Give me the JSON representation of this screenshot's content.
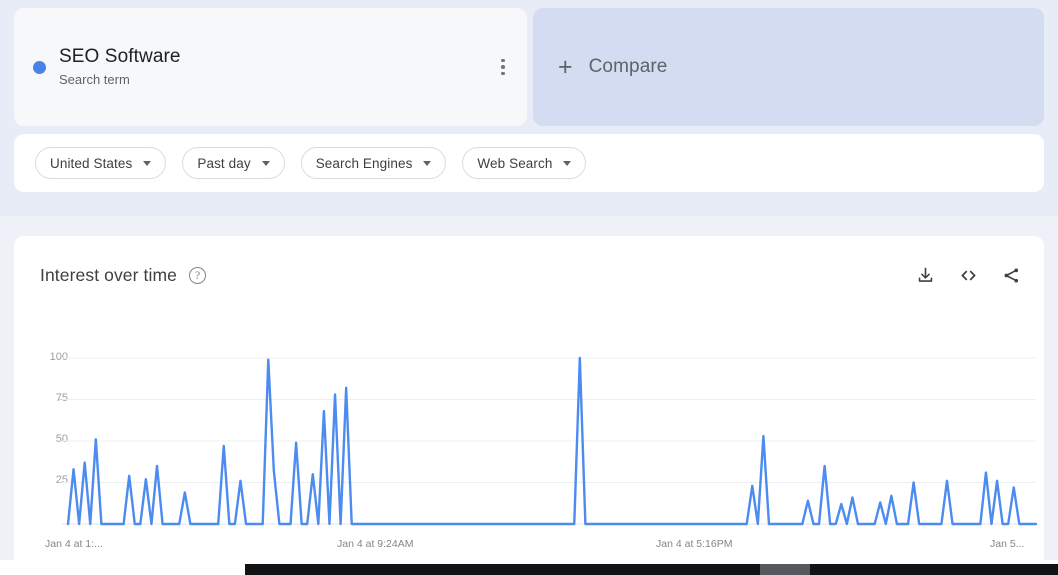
{
  "term_card": {
    "title": "SEO Software",
    "subtitle": "Search term",
    "dot_color": "#4a83e8",
    "menu_icon": "more-vert-icon"
  },
  "compare_card": {
    "plus": "+",
    "label": "Compare"
  },
  "filters": [
    {
      "label": "United States",
      "icon": "chevron-down-icon"
    },
    {
      "label": "Past day",
      "icon": "chevron-down-icon"
    },
    {
      "label": "Search Engines",
      "icon": "chevron-down-icon"
    },
    {
      "label": "Web Search",
      "icon": "chevron-down-icon"
    }
  ],
  "chart_panel": {
    "title": "Interest over time",
    "help_icon": "help-circle-icon",
    "help_glyph": "?",
    "actions": [
      {
        "name": "download-icon",
        "title": "Download"
      },
      {
        "name": "embed-code-icon",
        "title": "Embed"
      },
      {
        "name": "share-icon",
        "title": "Share"
      }
    ]
  },
  "chart_data": {
    "type": "line",
    "title": "Interest over time",
    "xlabel": "",
    "ylabel": "",
    "ylim": [
      0,
      100
    ],
    "grid": true,
    "legend": false,
    "line_color": "#4c8bf0",
    "y_ticks": [
      100,
      75,
      50,
      25
    ],
    "x_tick_labels": [
      "Jan 4 at 1:...",
      "Jan 4 at 9:24AM",
      "Jan 4 at 5:16PM",
      "Jan 5..."
    ],
    "x_tick_positions": [
      0,
      0.333,
      0.666,
      1.0
    ],
    "series": [
      {
        "name": "SEO Software",
        "values": [
          0,
          33,
          0,
          37,
          0,
          51,
          0,
          0,
          0,
          0,
          0,
          29,
          0,
          0,
          27,
          0,
          35,
          0,
          0,
          0,
          0,
          19,
          0,
          0,
          0,
          0,
          0,
          0,
          47,
          0,
          0,
          26,
          0,
          0,
          0,
          0,
          99,
          32,
          0,
          0,
          0,
          49,
          0,
          0,
          30,
          0,
          68,
          0,
          78,
          0,
          82,
          0,
          0,
          0,
          0,
          0,
          0,
          0,
          0,
          0,
          0,
          0,
          0,
          0,
          0,
          0,
          0,
          0,
          0,
          0,
          0,
          0,
          0,
          0,
          0,
          0,
          0,
          0,
          0,
          0,
          0,
          0,
          0,
          0,
          0,
          0,
          0,
          0,
          0,
          0,
          0,
          0,
          100,
          0,
          0,
          0,
          0,
          0,
          0,
          0,
          0,
          0,
          0,
          0,
          0,
          0,
          0,
          0,
          0,
          0,
          0,
          0,
          0,
          0,
          0,
          0,
          0,
          0,
          0,
          0,
          0,
          0,
          0,
          23,
          0,
          53,
          0,
          0,
          0,
          0,
          0,
          0,
          0,
          14,
          0,
          0,
          35,
          0,
          0,
          12,
          0,
          16,
          0,
          0,
          0,
          0,
          13,
          0,
          17,
          0,
          0,
          0,
          25,
          0,
          0,
          0,
          0,
          0,
          26,
          0,
          0,
          0,
          0,
          0,
          0,
          31,
          0,
          26,
          0,
          0,
          22,
          0,
          0,
          0,
          0
        ]
      }
    ]
  },
  "scrollbar": {
    "name": "horizontal-scrollbar",
    "thumb_name": "scrollbar-thumb"
  }
}
